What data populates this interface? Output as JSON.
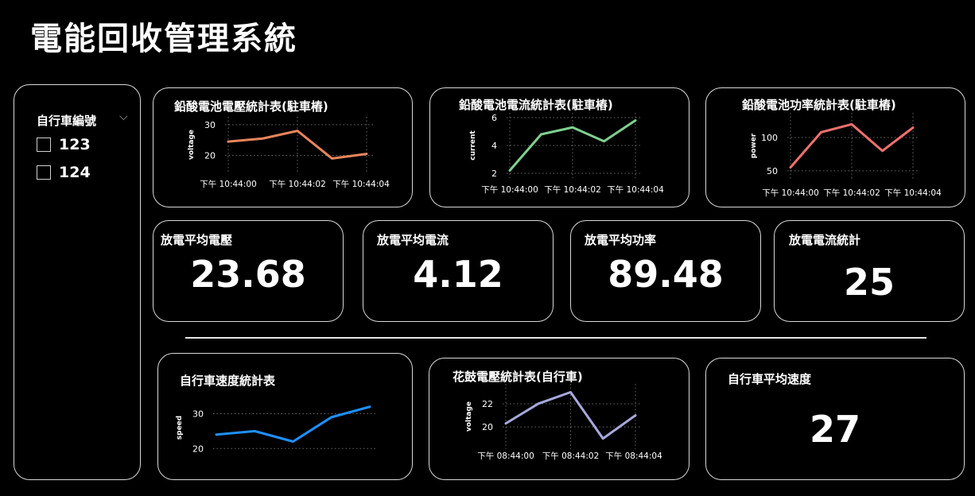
{
  "header": {
    "title": "電能回收管理系統"
  },
  "slicer": {
    "title": "自行車編號",
    "items": [
      {
        "label": "123",
        "checked": false
      },
      {
        "label": "124",
        "checked": false
      }
    ]
  },
  "kpis": {
    "avg_voltage": {
      "label": "放電平均電壓",
      "value": "23.68"
    },
    "avg_current": {
      "label": "放電平均電流",
      "value": "4.12"
    },
    "avg_power": {
      "label": "放電平均功率",
      "value": "89.48"
    },
    "current_count": {
      "label": "放電電流統計",
      "value": "25"
    },
    "bike_avg_speed": {
      "label": "自行車平均速度",
      "value": "27"
    }
  },
  "chart_data": [
    {
      "id": "battery_voltage",
      "type": "line",
      "title": "鉛酸電池電壓統計表(駐車樁)",
      "ylabel": "voltage",
      "color": "#e8855b",
      "x": [
        0,
        1,
        2,
        3,
        4
      ],
      "y": [
        24.5,
        25.5,
        28,
        19,
        20.5
      ],
      "ylim": [
        16,
        31
      ],
      "yticks": [
        20,
        30
      ],
      "xticks": [
        {
          "x": 0,
          "label": "下午 10:44:00"
        },
        {
          "x": 2,
          "label": "下午 10:44:02"
        },
        {
          "x": 4,
          "label": "下午 10:44:04"
        }
      ]
    },
    {
      "id": "battery_current",
      "type": "line",
      "title": "鉛酸電池電流統計表(駐車樁)",
      "ylabel": "current",
      "color": "#7ed090",
      "x": [
        0,
        1,
        2,
        3,
        4
      ],
      "y": [
        2.2,
        4.8,
        5.3,
        4.3,
        5.8
      ],
      "ylim": [
        2,
        6
      ],
      "yticks": [
        2,
        4,
        6
      ],
      "xticks": [
        {
          "x": 0,
          "label": "下午 10:44:00"
        },
        {
          "x": 2,
          "label": "下午 10:44:02"
        },
        {
          "x": 4,
          "label": "下午 10:44:04"
        }
      ]
    },
    {
      "id": "battery_power",
      "type": "line",
      "title": "鉛酸電池功率統計表(駐車樁)",
      "ylabel": "power",
      "color": "#f07070",
      "x": [
        0,
        1,
        2,
        3,
        4
      ],
      "y": [
        55,
        108,
        120,
        80,
        115
      ],
      "ylim": [
        45,
        130
      ],
      "yticks": [
        50,
        100
      ],
      "xticks": [
        {
          "x": 0,
          "label": "下午 10:44:00"
        },
        {
          "x": 2,
          "label": "下午 10:44:02"
        },
        {
          "x": 4,
          "label": "下午 10:44:04"
        }
      ]
    },
    {
      "id": "bike_speed",
      "type": "line",
      "title": "自行車速度統計表",
      "ylabel": "speed",
      "color": "#1e90ff",
      "x": [
        0,
        1,
        2,
        3,
        4
      ],
      "y": [
        24,
        25,
        22,
        29,
        32
      ],
      "ylim": [
        18,
        34
      ],
      "yticks": [
        20,
        30
      ],
      "xticks": []
    },
    {
      "id": "hub_voltage",
      "type": "line",
      "title": "花鼓電壓統計表(自行車)",
      "ylabel": "voltage",
      "color": "#a8a8dc",
      "x": [
        0,
        1,
        2,
        3,
        4
      ],
      "y": [
        20.3,
        22,
        23,
        19,
        21
      ],
      "ylim": [
        18.5,
        23.3
      ],
      "yticks": [
        20,
        22
      ],
      "xticks": [
        {
          "x": 0,
          "label": "下午 08:44:00"
        },
        {
          "x": 2,
          "label": "下午 08:44:02"
        },
        {
          "x": 4,
          "label": "下午 08:44:04"
        }
      ]
    }
  ]
}
